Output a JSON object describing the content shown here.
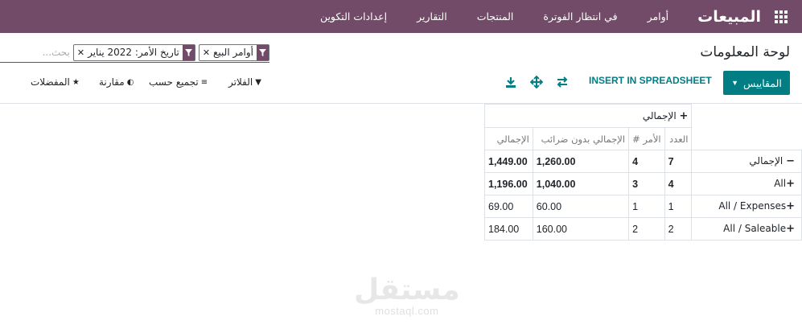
{
  "navbar": {
    "brand": "المبيعات",
    "menu": [
      "أوامر",
      "في انتظار الفوترة",
      "المنتجات",
      "التقارير",
      "إعدادات التكوين"
    ],
    "color": "#714b67"
  },
  "breadcrumb": {
    "title": "لوحة المعلومات"
  },
  "search": {
    "facets": [
      {
        "icon": "filter-icon",
        "value": "أوامر البيع"
      },
      {
        "icon": "filter-icon",
        "value": "تاريخ الأمر: 2022 يناير"
      }
    ],
    "placeholder": "بحث..."
  },
  "toolbar": {
    "measures_label": "المقاييس",
    "insert_label": "INSERT IN SPREADSHEET",
    "icons": [
      "flip-axis-icon",
      "expand-all-icon",
      "download-icon"
    ],
    "accent": "#017e84"
  },
  "searchpanel": {
    "filters_label": "الفلاتر",
    "groupby_label": "تجميع حسب",
    "compare_label": "مقارنة",
    "favorites_label": "المفضلات"
  },
  "pivot": {
    "col_header": "الإجمالي",
    "measures": [
      "العدد",
      "الأمر #",
      "الإجمالي بدون ضرائب",
      "الإجمالي"
    ],
    "rows": [
      {
        "label": "الإجمالي",
        "count": "7",
        "orders": "4",
        "untaxed": "1,260.00",
        "total": "1,449.00"
      },
      {
        "label": "All",
        "count": "4",
        "orders": "3",
        "untaxed": "1,040.00",
        "total": "1,196.00"
      },
      {
        "label": "All / Expenses",
        "count": "1",
        "orders": "1",
        "untaxed": "60.00",
        "total": "69.00"
      },
      {
        "label": "All / Saleable",
        "count": "2",
        "orders": "2",
        "untaxed": "160.00",
        "total": "184.00"
      }
    ]
  },
  "watermark": {
    "main": "مستقل",
    "sub": "mostaql.com"
  }
}
